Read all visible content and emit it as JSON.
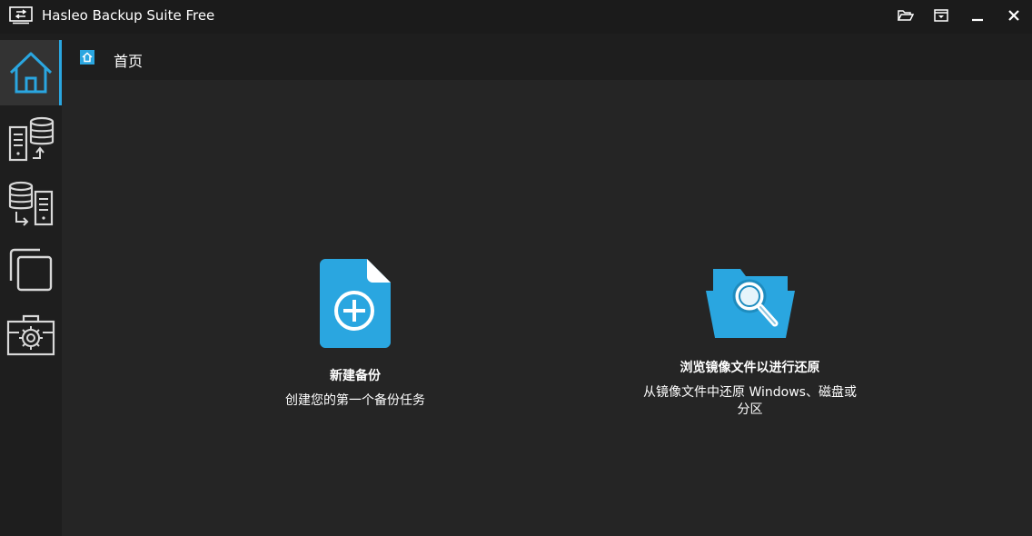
{
  "window": {
    "title": "Hasleo Backup Suite Free",
    "controls": [
      "folder-open-icon",
      "dropdown-menu-icon",
      "minimize-icon",
      "close-icon"
    ]
  },
  "sidebar": {
    "items": [
      {
        "name": "home",
        "icon": "home-icon",
        "active": true
      },
      {
        "name": "backup",
        "icon": "backup-server-icon",
        "active": false
      },
      {
        "name": "restore",
        "icon": "restore-database-icon",
        "active": false
      },
      {
        "name": "clone",
        "icon": "clone-icon",
        "active": false
      },
      {
        "name": "tools",
        "icon": "toolbox-gear-icon",
        "active": false
      }
    ]
  },
  "breadcrumb": {
    "label": "首页"
  },
  "cards": {
    "new_backup": {
      "title": "新建备份",
      "description": "创建您的第一个备份任务"
    },
    "browse_image": {
      "title": "浏览镜像文件以进行还原",
      "description_line1": "从镜像文件中还原 Windows、磁盘或",
      "description_line2": "分区"
    }
  },
  "colors": {
    "accent": "#2aa6e0",
    "background": "#252525",
    "panel": "#1e1e1e",
    "titlebar": "#1b1b1b"
  }
}
